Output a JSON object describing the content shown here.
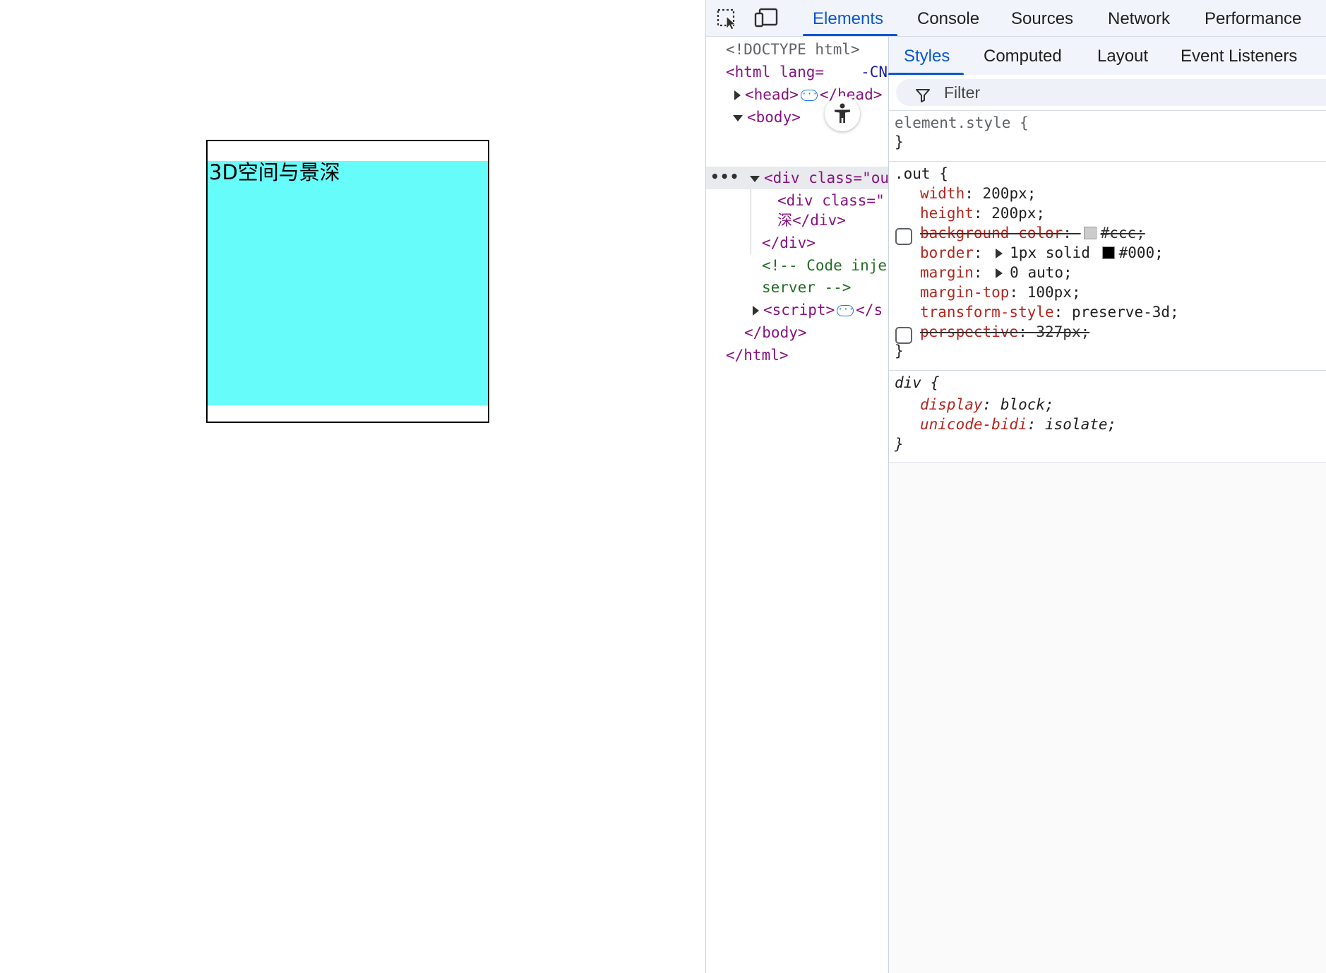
{
  "page": {
    "demo_text": "3D空间与景深",
    "demo_inner_color": "#66fcf9"
  },
  "devtools": {
    "main_tabs": [
      "Elements",
      "Console",
      "Sources",
      "Network",
      "Performance"
    ],
    "active_main_tab": "Elements",
    "icons": [
      "inspect-element-icon",
      "device-toolbar-icon",
      "accessibility-icon",
      "filter-icon"
    ],
    "dom_tree": {
      "doctype": "<!DOCTYPE html>",
      "html_open": "<html lang=",
      "html_attr_tail": "-CN'",
      "head": "<head>",
      "head_close": "</head>",
      "body": "<body>",
      "div_open": "<div class=\"ou",
      "div_inner": "<div class=\"",
      "div_inner_text": "深</div>",
      "div_close": "</div>",
      "comment_1": "<!-- Code inje",
      "comment_2": "server -->",
      "script": "<script>",
      "script_close": "</s",
      "body_close": "</body>",
      "html_close": "</html>",
      "ellipsis": "•••"
    },
    "styles": {
      "sub_tabs": [
        "Styles",
        "Computed",
        "Layout",
        "Event Listeners"
      ],
      "active_sub_tab": "Styles",
      "filter_placeholder": "Filter",
      "element_style_selector": "element.style {",
      "close_brace": "}",
      "out_rule": {
        "selector": ".out {",
        "width_prop": "width",
        "width_val": "200px;",
        "height_prop": "height",
        "height_val": "200px;",
        "bg_prop": "background-color",
        "bg_val": "#ccc;",
        "bg_color": "#cccccc",
        "border_prop": "border",
        "border_val_a": "1px solid",
        "border_val_b": "#000;",
        "border_color": "#000000",
        "margin_prop": "margin",
        "margin_val": "0 auto;",
        "margin_top_prop": "margin-top",
        "margin_top_val": "100px;",
        "transform_prop": "transform-style",
        "transform_val": "preserve-3d;",
        "perspective_prop": "perspective",
        "perspective_val": "327px;"
      },
      "div_rule": {
        "selector": "div {",
        "display_prop": "display",
        "display_val": "block;",
        "unicode_prop": "unicode-bidi",
        "unicode_val": "isolate;"
      }
    }
  }
}
